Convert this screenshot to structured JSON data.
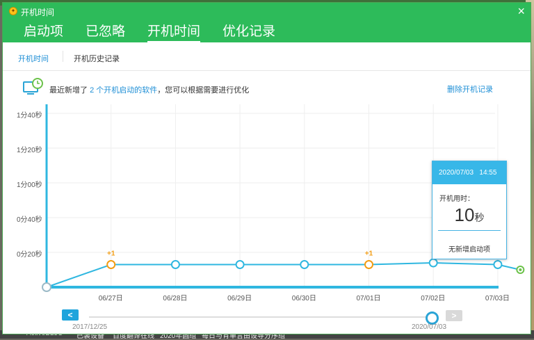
{
  "window": {
    "title": "开机时间",
    "close_symbol": "×"
  },
  "tabs": [
    {
      "label": "启动项",
      "active": false
    },
    {
      "label": "已忽略",
      "active": false
    },
    {
      "label": "开机时间",
      "active": true
    },
    {
      "label": "优化记录",
      "active": false
    }
  ],
  "subtabs": [
    {
      "label": "开机时间",
      "active": true
    },
    {
      "label": "开机历史记录",
      "active": false
    }
  ],
  "info": {
    "prefix": "最近新增了 ",
    "link": "2 个开机启动的软件",
    "suffix": "，您可以根据需要进行优化",
    "delete_label": "删除开机记录"
  },
  "chart_data": {
    "type": "line",
    "y_tick_labels": [
      "1分40秒",
      "1分20秒",
      "1分00秒",
      "0分40秒",
      "0分20秒"
    ],
    "ylim_seconds": [
      0,
      100
    ],
    "x_labels": [
      "06/27日",
      "06/28日",
      "06/29日",
      "06/30日",
      "07/01日",
      "07/02日",
      "07/03日"
    ],
    "points": [
      {
        "x": 0,
        "y": 0
      },
      {
        "x": 1,
        "y": 13,
        "badge": "+1"
      },
      {
        "x": 2,
        "y": 13
      },
      {
        "x": 3,
        "y": 13
      },
      {
        "x": 4,
        "y": 13
      },
      {
        "x": 5,
        "y": 13,
        "badge": "+1"
      },
      {
        "x": 6,
        "y": 14
      },
      {
        "x": 7,
        "y": 13
      },
      {
        "x": 7.35,
        "y": 10,
        "selected": true
      }
    ],
    "colors": {
      "line": "#2fb7e0",
      "axis": "#2fb7e0",
      "badge": "#f39c12",
      "selected": "#6cc24a",
      "grid": "#eeeeee"
    }
  },
  "tooltip": {
    "date": "2020/07/03",
    "time": "14:55",
    "label": "开机用时：",
    "value": "10",
    "unit": "秒",
    "footer": "无新增启动项"
  },
  "range_slider": {
    "start_date": "2017/12/25",
    "end_date": "2020/07/03",
    "prev_symbol": "<",
    "next_symbol": ">"
  },
  "background_taskbar": [
    "ActiveBL5C",
    "已装设备",
    "百度翻译在线",
    "2020年圆组",
    "每日与背单言",
    "由设导分序组"
  ]
}
